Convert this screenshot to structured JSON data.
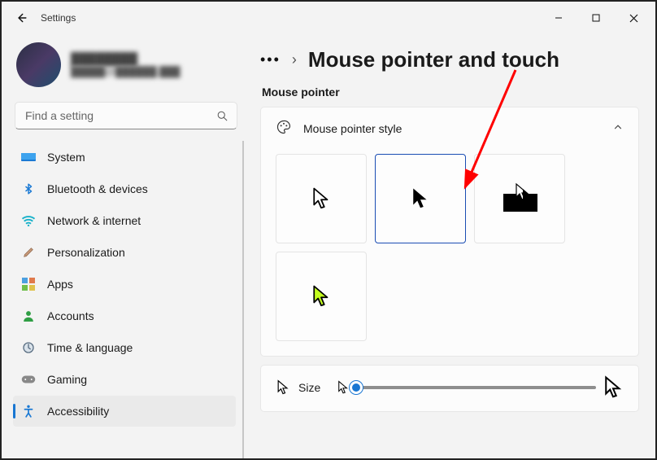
{
  "window": {
    "title": "Settings"
  },
  "account": {
    "name": "████████",
    "email": "█████@██████.███"
  },
  "search": {
    "placeholder": "Find a setting"
  },
  "sidebar": {
    "items": [
      {
        "label": "System",
        "icon": "monitor-icon",
        "color": "#1a79d4"
      },
      {
        "label": "Bluetooth & devices",
        "icon": "bluetooth-icon",
        "color": "#1a79d4"
      },
      {
        "label": "Network & internet",
        "icon": "wifi-icon",
        "color": "#18b1c9"
      },
      {
        "label": "Personalization",
        "icon": "paintbrush-icon",
        "color": "#9a6b4f"
      },
      {
        "label": "Apps",
        "icon": "apps-icon",
        "color": "#6e6e6e"
      },
      {
        "label": "Accounts",
        "icon": "person-icon",
        "color": "#2f9e44"
      },
      {
        "label": "Time & language",
        "icon": "clock-globe-icon",
        "color": "#5a6e82"
      },
      {
        "label": "Gaming",
        "icon": "gaming-icon",
        "color": "#6e6e6e"
      },
      {
        "label": "Accessibility",
        "icon": "accessibility-icon",
        "color": "#1a79d4",
        "selected": true
      }
    ]
  },
  "breadcrumb": {
    "title": "Mouse pointer and touch"
  },
  "section": {
    "label": "Mouse pointer"
  },
  "styleCard": {
    "title": "Mouse pointer style",
    "options": [
      {
        "id": "white",
        "selected": false
      },
      {
        "id": "black",
        "selected": true
      },
      {
        "id": "inverted",
        "selected": false
      },
      {
        "id": "custom",
        "selected": false
      }
    ]
  },
  "sizeCard": {
    "label": "Size",
    "value_percent": 0
  },
  "annotation": {
    "text": "Mouse pointer and touch",
    "target": "page title"
  }
}
